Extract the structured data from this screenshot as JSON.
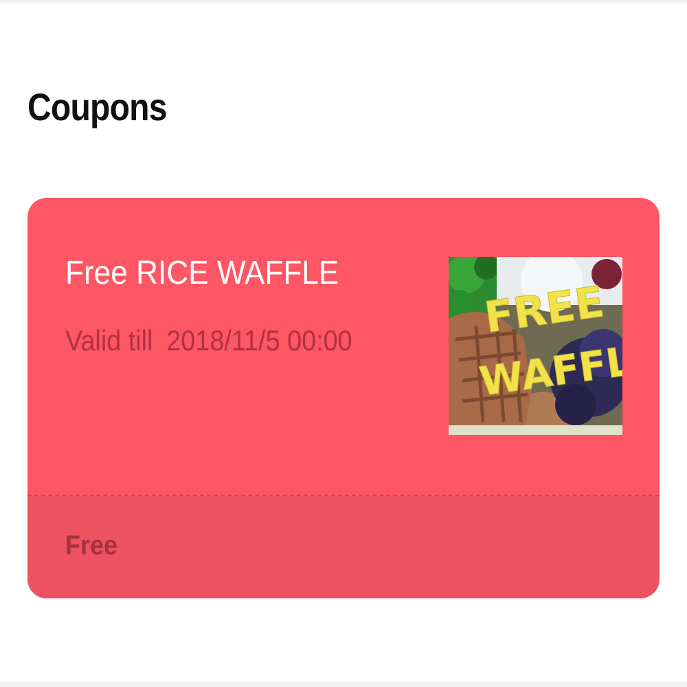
{
  "page": {
    "title": "Coupons"
  },
  "coupon": {
    "title": "Free RICE WAFFLE",
    "validity_label": "Valid till",
    "validity_date": "2018/11/5 00:00",
    "price": "Free",
    "image": {
      "line1": "FREE",
      "line2": "WAFFLE"
    }
  },
  "colors": {
    "card": "#fd5665",
    "card_footer": "#ec5260",
    "validity_text": "#b3303f",
    "price_text": "#a8313d",
    "image_text": "#f2e24a"
  }
}
